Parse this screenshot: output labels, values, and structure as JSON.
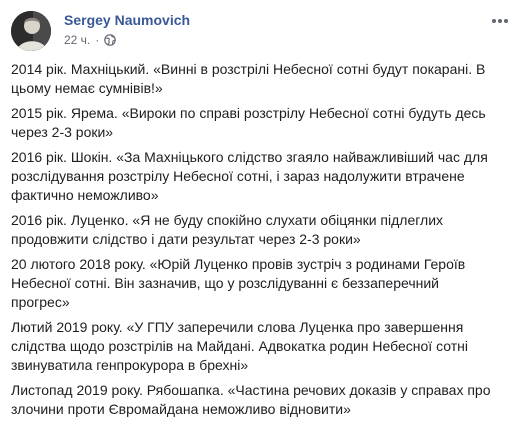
{
  "post": {
    "author": "Sergey Naumovich",
    "time": "22 ч.",
    "separator": "·",
    "privacy_icon": "globe-icon",
    "more_icon": "more-horizontal-icon",
    "paragraphs": [
      "2014 рік. Махніцький. «Винні в розстрілі Небесної сотні будут покарані. В цьому немає сумнівів!»",
      "2015 рік. Ярема. «Вироки по справі розстрілу Небесної сотні будуть десь через 2-3 роки»",
      "2016 рік. Шокін. «За Махніцького слідство згаяло найважливіший час для розслідування розстрілу Небесної сотні, і зараз надолужити втрачене фактично неможливо»",
      "2016 рік. Луценко. «Я не буду спокійно слухати обіцянки підлеглих продовжити слідство і дати результат через 2-3 роки»",
      "20 лютого 2018 року. «Юрій Луценко провів зустріч з родинами Героїв Небесної сотні. Він зазначив, що у розслідуванні є беззаперечний прогрес»",
      "Лютий 2019 року. «У ГПУ заперечили слова Луценка про завершення слідства щодо розстрілів на Майдані. Адвокатка родин Небесної сотні звинуватила генпрокурора в брехні»",
      "Листопад 2019 року. Рябошапка. «Частина речових доказів у справах про злочини проти Євромайдана неможливо відновити»"
    ]
  },
  "colors": {
    "author_link": "#385898",
    "meta_text": "#616770",
    "body_text": "#1c1e21"
  }
}
